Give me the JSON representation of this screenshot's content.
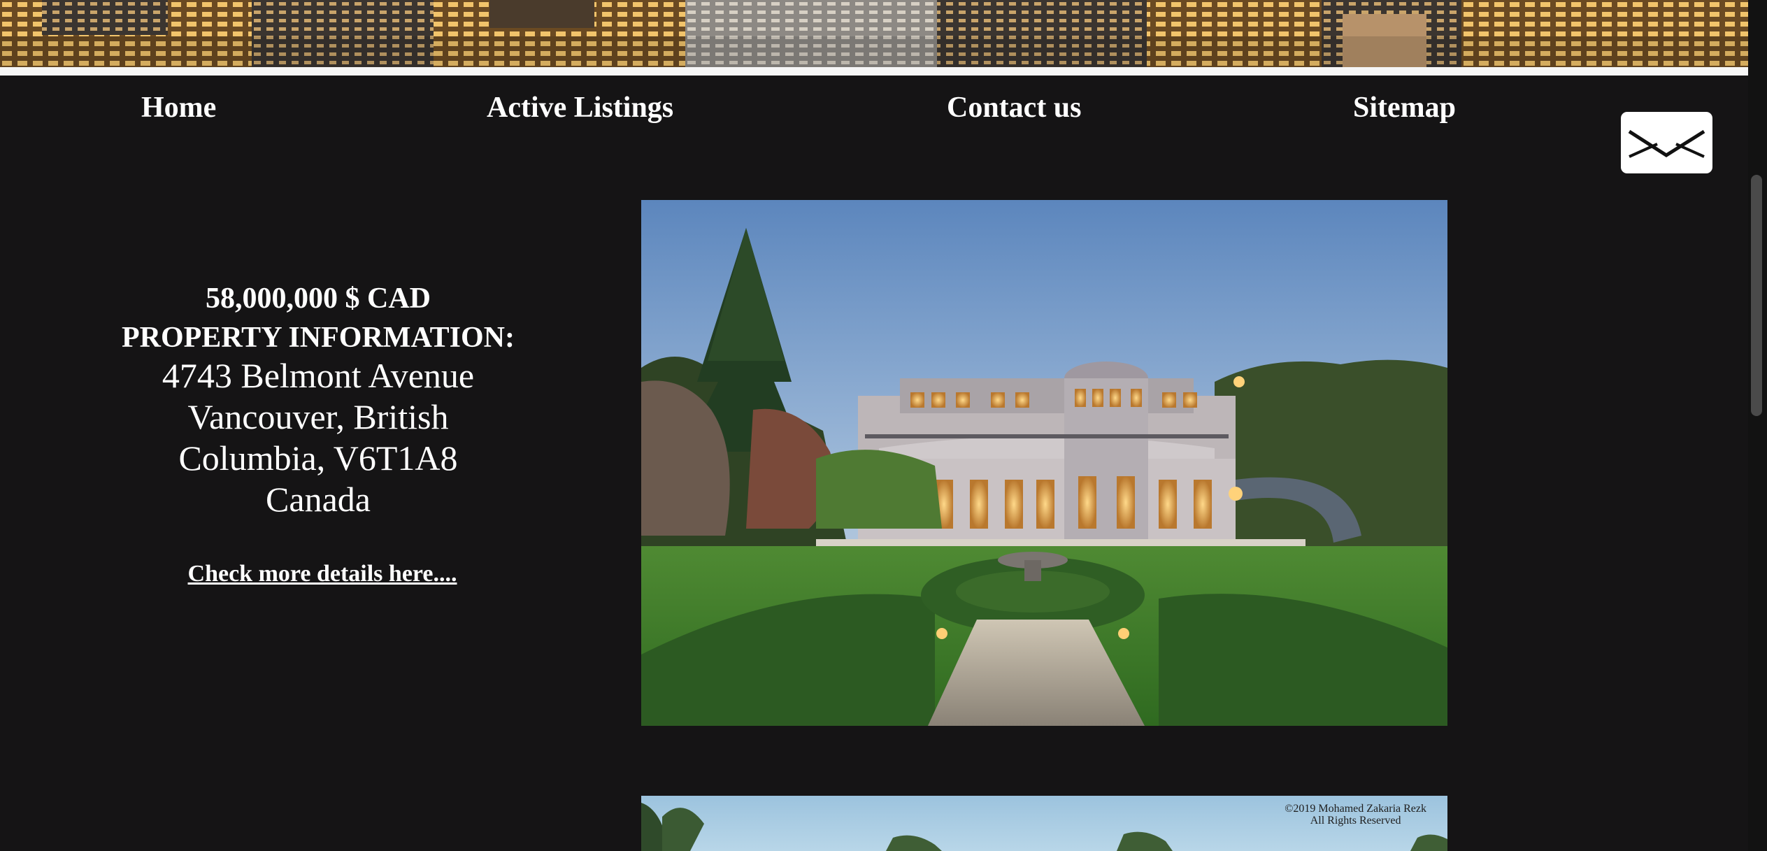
{
  "nav": {
    "home": "Home",
    "active_listings": "Active Listings",
    "contact_us": "Contact us",
    "sitemap": "Sitemap"
  },
  "icons": {
    "mail": "envelope-icon"
  },
  "listing": {
    "price": "58,000,000 $ CAD",
    "heading": "PROPERTY INFORMATION:",
    "address_lines": [
      "4743 Belmont Avenue",
      "Vancouver, British",
      "Columbia, V6T1A8",
      "Canada"
    ],
    "details_link": "Check more details here...."
  },
  "watermark": {
    "line1": "©2019 Mohamed Zakaria Rezk",
    "line2": "All Rights Reserved"
  },
  "colors": {
    "background": "#151415",
    "text": "#ffffff",
    "mail_button": "#ffffff"
  }
}
